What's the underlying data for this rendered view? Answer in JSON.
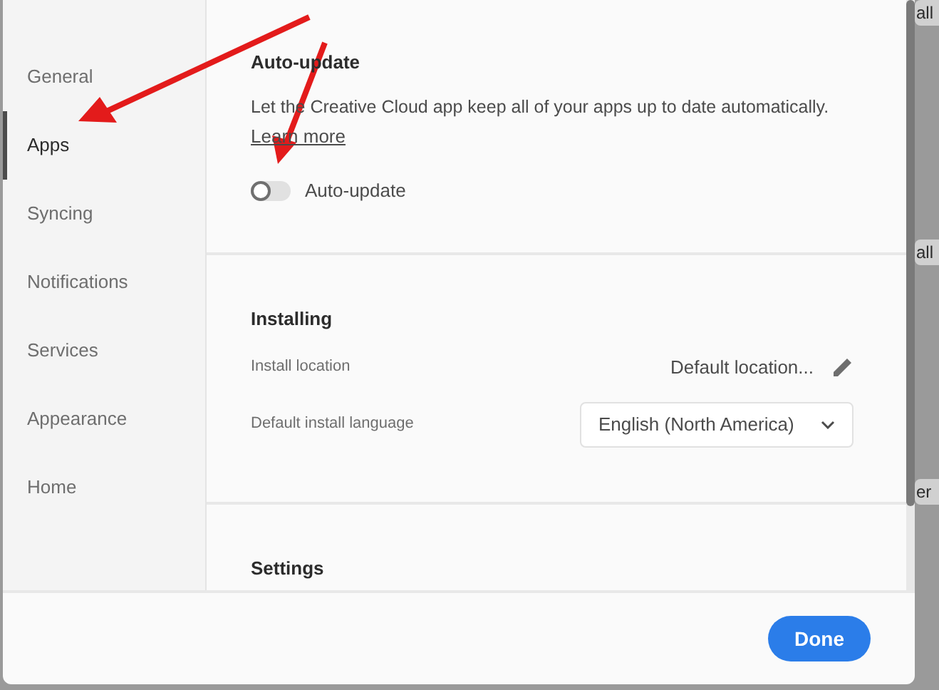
{
  "sidebar": {
    "items": [
      {
        "label": "General",
        "selected": false
      },
      {
        "label": "Apps",
        "selected": true
      },
      {
        "label": "Syncing",
        "selected": false
      },
      {
        "label": "Notifications",
        "selected": false
      },
      {
        "label": "Services",
        "selected": false
      },
      {
        "label": "Appearance",
        "selected": false
      },
      {
        "label": "Home",
        "selected": false
      }
    ]
  },
  "auto_update": {
    "title": "Auto-update",
    "description": "Let the Creative Cloud app keep all of your apps up to date automatically.",
    "link": "Learn more",
    "toggle": {
      "label": "Auto-update",
      "on": false
    }
  },
  "installing": {
    "title": "Installing",
    "install_location": {
      "label": "Install location",
      "value": "Default location..."
    },
    "default_language": {
      "label": "Default install language",
      "value": "English (North America)"
    }
  },
  "settings": {
    "title": "Settings"
  },
  "footer": {
    "done_button": "Done"
  },
  "background_fragments": [
    "all",
    "all",
    "er"
  ]
}
